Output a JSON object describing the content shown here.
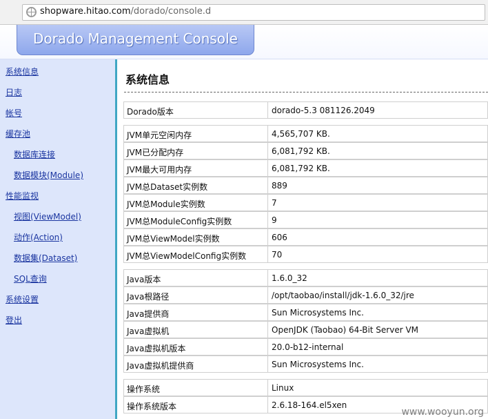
{
  "browser": {
    "url_host": "shopware.hitao.com",
    "url_path": "/dorado/console.d"
  },
  "banner": {
    "title": "Dorado Management Console"
  },
  "sidebar": {
    "items": [
      {
        "label": "系统信息"
      },
      {
        "label": "日志"
      },
      {
        "label": "帐号"
      },
      {
        "label": "缓存池"
      },
      {
        "label": "数据库连接"
      },
      {
        "label": "数据模块(Module)"
      },
      {
        "label": "性能监视"
      },
      {
        "label": "视图(ViewModel)"
      },
      {
        "label": "动作(Action)"
      },
      {
        "label": "数据集(Dataset)"
      },
      {
        "label": "SQL查询"
      },
      {
        "label": "系统设置"
      },
      {
        "label": "登出"
      }
    ]
  },
  "main": {
    "title": "系统信息",
    "rows": [
      {
        "key": "Dorado版本",
        "value": "dorado-5.3 081126.2049"
      },
      {
        "key": "JVM单元空闲内存",
        "value": "4,565,707 KB."
      },
      {
        "key": "JVM已分配内存",
        "value": "6,081,792 KB."
      },
      {
        "key": "JVM最大可用内存",
        "value": "6,081,792 KB."
      },
      {
        "key": "JVM总Dataset实例数",
        "value": "889"
      },
      {
        "key": "JVM总Module实例数",
        "value": "7"
      },
      {
        "key": "JVM总ModuleConfig实例数",
        "value": "9"
      },
      {
        "key": "JVM总ViewModel实例数",
        "value": "606"
      },
      {
        "key": "JVM总ViewModelConfig实例数",
        "value": "70"
      },
      {
        "key": "Java版本",
        "value": "1.6.0_32"
      },
      {
        "key": "Java根路径",
        "value": "/opt/taobao/install/jdk-1.6.0_32/jre"
      },
      {
        "key": "Java提供商",
        "value": "Sun Microsystems Inc."
      },
      {
        "key": "Java虚拟机",
        "value": "OpenJDK (Taobao) 64-Bit Server VM"
      },
      {
        "key": "Java虚拟机版本",
        "value": "20.0-b12-internal"
      },
      {
        "key": "Java虚拟机提供商",
        "value": "Sun Microsystems Inc."
      },
      {
        "key": "操作系统",
        "value": "Linux"
      },
      {
        "key": "操作系统版本",
        "value": "2.6.18-164.el5xen"
      }
    ]
  },
  "watermark": "www.wooyun.org"
}
